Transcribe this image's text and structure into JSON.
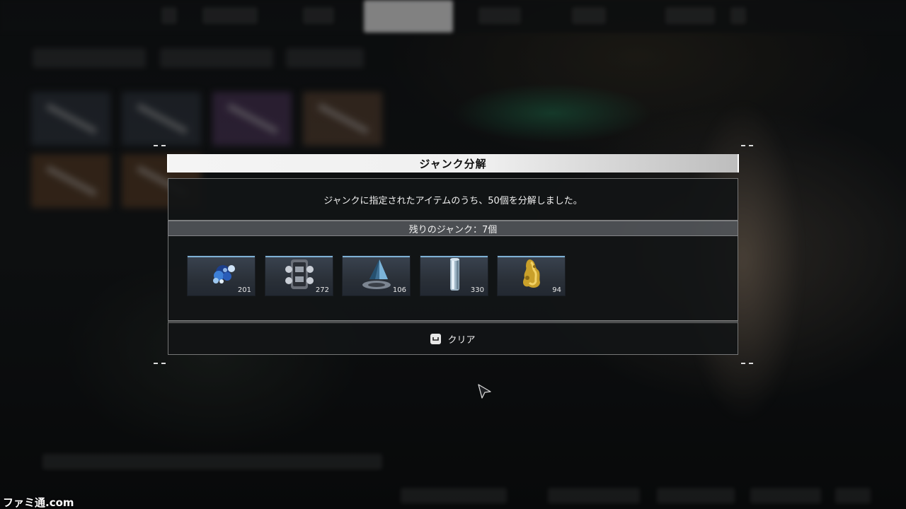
{
  "dialog": {
    "title": "ジャンク分解",
    "message": "ジャンクに指定されたアイテムのうち、50個を分解しました。",
    "remaining": "残りのジャンク：7個",
    "items": [
      {
        "icon": "crystal-cluster-icon",
        "count": "201"
      },
      {
        "icon": "mechanical-part-icon",
        "count": "272"
      },
      {
        "icon": "prism-core-icon",
        "count": "106"
      },
      {
        "icon": "metal-cylinder-icon",
        "count": "330"
      },
      {
        "icon": "gold-ore-icon",
        "count": "94"
      }
    ],
    "clear": {
      "key_icon": "space-key-icon",
      "label": "クリア"
    }
  },
  "watermark": "ファミ通.com",
  "colors": {
    "accent_line": "#7fb2d6",
    "title_bg": "#f0f0f0",
    "panel_bg": "#121416"
  }
}
